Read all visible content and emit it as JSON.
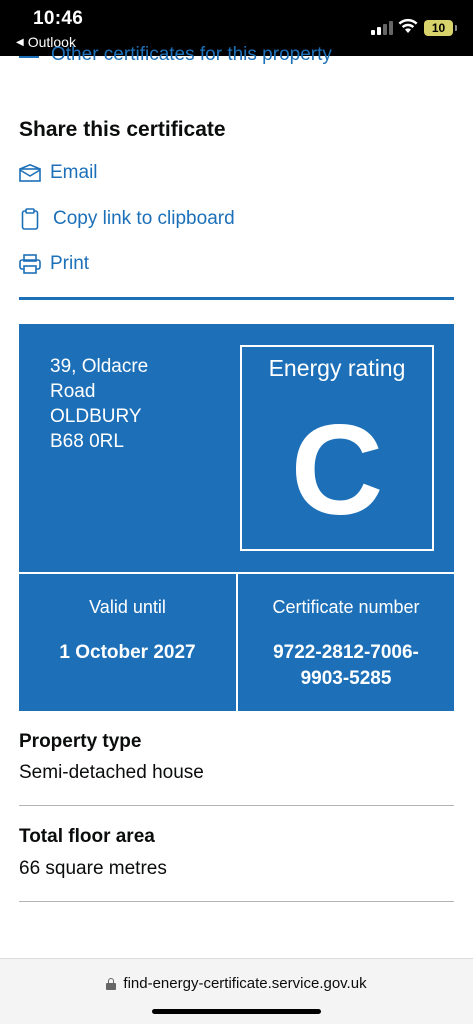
{
  "status_bar": {
    "time": "10:46",
    "back_app": "Outlook",
    "battery": "10"
  },
  "partial_link": "Other certificates for this property",
  "share": {
    "title": "Share this certificate",
    "items": [
      {
        "icon": "envelope-icon",
        "label": "Email"
      },
      {
        "icon": "clipboard-icon",
        "label": "Copy link to clipboard"
      },
      {
        "icon": "printer-icon",
        "label": "Print"
      }
    ]
  },
  "certificate": {
    "address_lines": [
      "39, Oldacre",
      "Road",
      "OLDBURY",
      "B68 0RL"
    ],
    "rating_label": "Energy rating",
    "rating": "C",
    "valid_label": "Valid until",
    "valid_value": "1 October 2027",
    "number_label": "Certificate number",
    "number_value_line1": "9722-2812-7006-",
    "number_value_line2": "9903-5285",
    "color": "#1d70b8"
  },
  "property_type": {
    "label": "Property type",
    "value": "Semi-detached house"
  },
  "floor_area": {
    "label": "Total floor area",
    "value": "66 square metres"
  },
  "browser": {
    "url": "find-energy-certificate.service.gov.uk"
  }
}
